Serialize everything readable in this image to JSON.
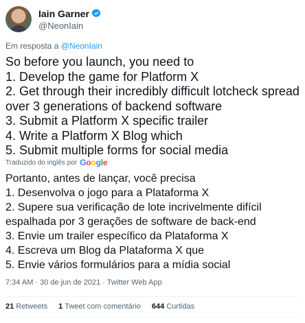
{
  "author": {
    "display_name": "Iain Garner",
    "handle": "@NeonIain",
    "verified_color": "#1d9bf0"
  },
  "reply_context": {
    "prefix": "Em resposta a",
    "mention": "@NeonIain"
  },
  "tweet_text_lines": [
    "So before you launch, you need to",
    "1. Develop the game for Platform X",
    "2. Get through their incredibly difficult lotcheck spread",
    "over 3 generations of backend software",
    "3. Submit a Platform X specific trailer",
    "4. Write a Platform X Blog which",
    "5. Submit multiple forms for social media"
  ],
  "translation": {
    "label": "Traduzido do inglês por",
    "provider": "Google",
    "lines": [
      "Portanto, antes de lançar, você precisa",
      " 1. Desenvolva o jogo para a Plataforma X",
      " 2. Supere sua verificação de lote incrivelmente difícil",
      "espalhada por 3 gerações de software de back-end",
      " 3. Envie um trailer específico da Plataforma X",
      " 4. Escreva um Blog da Plataforma X que",
      " 5. Envie vários formulários para a mídia social"
    ]
  },
  "meta": {
    "timestamp": "7:34 AM · 30 de jun de 2021 · Twitter Web App"
  },
  "stats": {
    "retweets_count": "21",
    "retweets_label": "Retweets",
    "quote_count": "1",
    "quote_label": "Tweet com comentário",
    "likes_count": "644",
    "likes_label": "Curtidas"
  }
}
